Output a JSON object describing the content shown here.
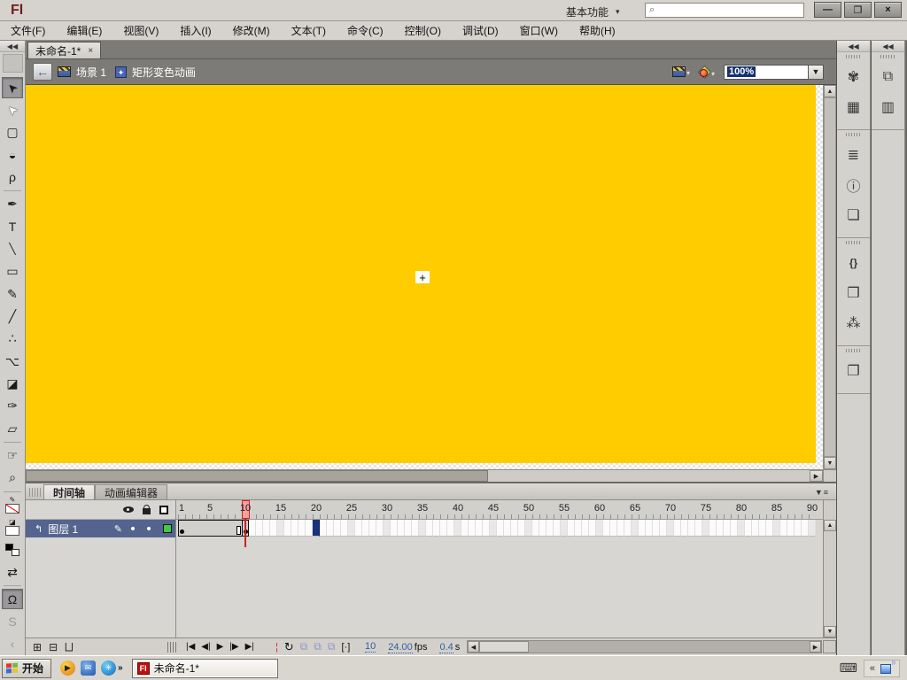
{
  "window": {
    "logo": "Fl",
    "workspace_switcher": "基本功能",
    "workspace_caret": "▾",
    "search_icon": "⌕",
    "minimize": "—",
    "restore": "❐",
    "close": "×"
  },
  "menu_bar": {
    "items": [
      {
        "label": "文件(F)"
      },
      {
        "label": "编辑(E)"
      },
      {
        "label": "视图(V)"
      },
      {
        "label": "插入(I)"
      },
      {
        "label": "修改(M)"
      },
      {
        "label": "文本(T)"
      },
      {
        "label": "命令(C)"
      },
      {
        "label": "控制(O)"
      },
      {
        "label": "调试(D)"
      },
      {
        "label": "窗口(W)"
      },
      {
        "label": "帮助(H)"
      }
    ]
  },
  "document": {
    "tab_title": "未命名-1*",
    "tab_close": "×"
  },
  "edit_bar": {
    "back_arrow": "←",
    "scene_label": "场景 1",
    "symbol_icon_glyph": "✦",
    "symbol_label": "矩形变色动画",
    "edit_scene_caret": "▾",
    "edit_symbol_caret": "▾",
    "zoom_value": "100%",
    "zoom_caret": "▼"
  },
  "tools": {
    "collapse": "◀◀",
    "items": [
      {
        "name": "selection-tool",
        "glyph": "➤",
        "selected": true
      },
      {
        "name": "subselection-tool",
        "glyph": "➤"
      },
      {
        "name": "free-transform-tool",
        "glyph": "▢"
      },
      {
        "name": "threed-rotation-tool",
        "glyph": "◒"
      },
      {
        "name": "lasso-tool",
        "glyph": "ρ"
      },
      {
        "name": "divider"
      },
      {
        "name": "pen-tool",
        "glyph": "✒"
      },
      {
        "name": "text-tool",
        "glyph": "T"
      },
      {
        "name": "line-tool",
        "glyph": "╲"
      },
      {
        "name": "rectangle-tool",
        "glyph": "▭"
      },
      {
        "name": "pencil-tool",
        "glyph": "✎"
      },
      {
        "name": "brush-tool",
        "glyph": "╱"
      },
      {
        "name": "spray-brush-tool",
        "glyph": "∴"
      },
      {
        "name": "bone-tool",
        "glyph": "⌥"
      },
      {
        "name": "paint-bucket-tool",
        "glyph": "◪"
      },
      {
        "name": "eyedropper-tool",
        "glyph": "✑"
      },
      {
        "name": "eraser-tool",
        "glyph": "▱"
      },
      {
        "name": "divider"
      },
      {
        "name": "hand-tool",
        "glyph": "☞"
      },
      {
        "name": "zoom-tool",
        "glyph": "⌕"
      },
      {
        "name": "divider"
      },
      {
        "name": "stroke-color-control",
        "composite": "stroke"
      },
      {
        "name": "fill-color-control",
        "composite": "fill"
      },
      {
        "name": "default-colors-control",
        "composite": "bw"
      },
      {
        "name": "swap-colors-control",
        "glyph": "⇄"
      },
      {
        "name": "divider"
      },
      {
        "name": "snap-to-objects-toggle",
        "glyph": "Ω",
        "selected": true
      },
      {
        "name": "smooth-option",
        "glyph": "S",
        "disabled": true
      },
      {
        "name": "straighten-option",
        "glyph": "‹",
        "disabled": true
      }
    ]
  },
  "stage": {
    "fill_color": "#FFCC00",
    "crosshair": "+"
  },
  "right_panels": {
    "collapse": "◀◀",
    "column1": [
      {
        "icons": [
          {
            "name": "color-panel",
            "glyph": "✾"
          },
          {
            "name": "swatches-panel",
            "glyph": "▦"
          }
        ]
      },
      {
        "icons": [
          {
            "name": "align-panel",
            "glyph": "≣"
          },
          {
            "name": "info-panel",
            "glyph": "ⓘ"
          },
          {
            "name": "transform-panel",
            "glyph": "❏"
          }
        ]
      },
      {
        "icons": [
          {
            "name": "code-snippets-panel",
            "glyph": "{}",
            "small": true
          },
          {
            "name": "components-panel",
            "glyph": "❒"
          },
          {
            "name": "component-inspector-panel",
            "glyph": "⁂"
          }
        ]
      },
      {
        "icons": [
          {
            "name": "project-panel",
            "glyph": "❐"
          }
        ]
      }
    ],
    "column2": [
      {
        "icons": [
          {
            "name": "properties-panel",
            "glyph": "⧉"
          },
          {
            "name": "library-panel",
            "glyph": "▥"
          }
        ]
      }
    ]
  },
  "timeline": {
    "tabs": [
      {
        "label": "时间轴",
        "active": true
      },
      {
        "label": "动画编辑器",
        "active": false
      }
    ],
    "panel_menu": "▼≡",
    "layer": {
      "name": "图层 1",
      "type_icon": "↰",
      "pencil": "✎",
      "outline_color": "#3ECC3E"
    },
    "ruler": {
      "numbers": [
        1,
        5,
        10,
        15,
        20,
        25,
        30,
        35,
        40,
        45,
        50,
        55,
        60,
        65,
        70,
        75,
        80,
        85,
        90
      ],
      "playhead_frame": 10,
      "total_frames": 90
    },
    "frames": {
      "span_start": 1,
      "span_end": 9,
      "keyframes": [
        1,
        10
      ],
      "selected_frame": 20,
      "selected_color": "#16337F"
    },
    "bottom": {
      "new_layer": "⊞",
      "new_folder": "⊟",
      "delete_layer": "⨆",
      "goto_first": "|◀",
      "step_back": "◀|",
      "play": "▶",
      "step_forward": "|▶",
      "goto_last": "▶|",
      "onion_marker": "¦",
      "loop": "↻",
      "onion_skin": "⧉",
      "onion_outlines": "⧉",
      "edit_multiple_frames": "⧉",
      "modify_markers": "[·]",
      "current_frame": "10",
      "frame_rate": "24.00",
      "fps_unit": "fps",
      "elapsed": "0.4",
      "elapsed_unit": "s"
    }
  },
  "taskbar": {
    "start_label": "开始",
    "quick_launch": [
      {
        "name": "quicklaunch-media-player",
        "glyph": "▶"
      },
      {
        "name": "quicklaunch-mail",
        "glyph": "✉"
      },
      {
        "name": "quicklaunch-settings",
        "glyph": "✳"
      }
    ],
    "more_chevron": "»",
    "task_button": {
      "icon": "Fl",
      "label": "未命名-1*"
    },
    "tray": {
      "keyboard": "⌨",
      "chevron": "«"
    }
  }
}
